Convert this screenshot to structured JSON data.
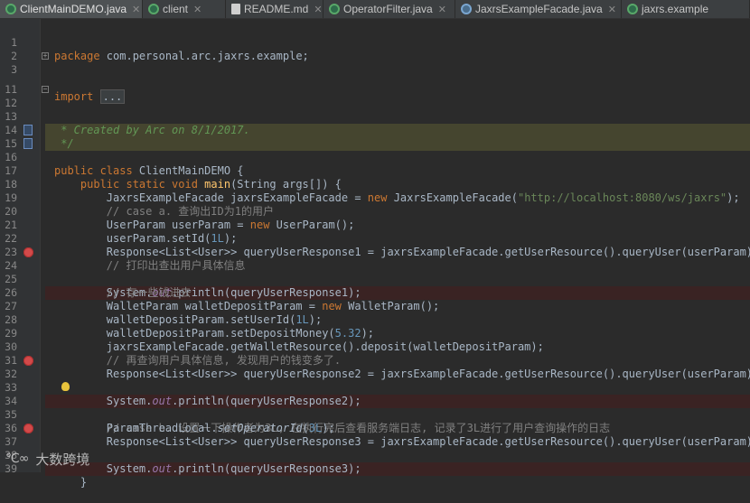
{
  "tabs": [
    {
      "label": "ClientMainDEMO.java",
      "icon": "java-class-icon",
      "active": true
    },
    {
      "label": "client",
      "icon": "java-class-icon",
      "active": false
    },
    {
      "label": "README.md",
      "icon": "document-icon",
      "active": false
    },
    {
      "label": "OperatorFilter.java",
      "icon": "java-class-icon",
      "active": false
    },
    {
      "label": "JaxrsExampleFacade.java",
      "icon": "interface-icon",
      "active": false
    },
    {
      "label": "jaxrs.example",
      "icon": "java-class-icon",
      "active": false
    }
  ],
  "code": {
    "l1": {
      "n": "1",
      "a": "package",
      "b": " com.personal.arc.jaxrs.example;"
    },
    "l2": {
      "n": "2"
    },
    "l3": {
      "n": "3",
      "a": "import",
      "b": "..."
    },
    "l11": {
      "n": "11"
    },
    "l12": {
      "n": "12",
      "a": "/**"
    },
    "l13": {
      "n": "13",
      "a": " * Created by Arc on 8/1/2017."
    },
    "l14": {
      "n": "14",
      "a": " */"
    },
    "l15": {
      "n": "15",
      "a": "public class",
      "b": " ClientMainDEMO {"
    },
    "l16": {
      "n": "16",
      "a": "    public static void",
      "b": " main",
      "c": "(String args[]) {"
    },
    "l17": {
      "n": "17"
    },
    "l18": {
      "n": "18",
      "a": "        JaxrsExampleFacade jaxrsExampleFacade = ",
      "b": "new",
      "c": " JaxrsExampleFacade(",
      "d": "\"http://localhost:8080/ws/jaxrs\"",
      "e": ");"
    },
    "l19": {
      "n": "19",
      "a": "        // case a. 查询出ID为1的用户"
    },
    "l20": {
      "n": "20",
      "a": "        UserParam userParam = ",
      "b": "new",
      "c": " UserParam();"
    },
    "l21": {
      "n": "21",
      "a": "        userParam.setId(",
      "b": "1L",
      "c": ");"
    },
    "l22": {
      "n": "22",
      "a": "        Response<List<User>> queryUserResponse1 = jaxrsExampleFacade.getUserResource().queryUser(userParam);"
    },
    "l23": {
      "n": "23",
      "a": "        // 打印出查出用户具体信息"
    },
    "l24": {
      "n": "24",
      "a": "        System.",
      "b": "out",
      "c": ".println(queryUserResponse1);"
    },
    "l25": {
      "n": "25",
      "a": "        // 存一些钱进去"
    },
    "l26": {
      "n": "26",
      "a": "        WalletParam walletDepositParam = ",
      "b": "new",
      "c": " WalletParam();"
    },
    "l27": {
      "n": "27",
      "a": "        walletDepositParam.setUserId(",
      "b": "1L",
      "c": ");"
    },
    "l28": {
      "n": "28",
      "a": "        walletDepositParam.setDepositMoney(",
      "b": "5.32",
      "c": ");"
    },
    "l29": {
      "n": "29",
      "a": "        jaxrsExampleFacade.getWalletResource().deposit(walletDepositParam);"
    },
    "l30": {
      "n": "30",
      "a": "        // 再查询用户具体信息, 发现用户的钱变多了."
    },
    "l31": {
      "n": "31",
      "a": "        Response<List<User>> queryUserResponse2 = jaxrsExampleFacade.getUserResource().queryUser(userParam);"
    },
    "l32": {
      "n": "32",
      "a": "        System.",
      "b": "out",
      "c": ".println(queryUserResponse2);"
    },
    "l33": {
      "n": "33"
    },
    "l34": {
      "n": "34",
      "a": "        // case b. 设置一下操作者为3L, 在执行完后查看服务端日志, 记录了3L进行了用户查询操作的日志"
    },
    "l35": {
      "n": "35",
      "a": "        ParamThreadLocal.",
      "b": "setOperatorId",
      "c": "(",
      "d": "3L",
      "e": ");"
    },
    "l36": {
      "n": "36",
      "a": "        Response<List<User>> queryUserResponse3 = jaxrsExampleFacade.getUserResource().queryUser(userParam);"
    },
    "l37": {
      "n": "37",
      "a": "        System.",
      "b": "out",
      "c": ".println(queryUserResponse3);"
    },
    "l38": {
      "n": "38"
    },
    "l39": {
      "n": "39",
      "a": "    }"
    }
  },
  "watermark": {
    "text": "大数跨境"
  },
  "colors": {
    "keyword": "#cc7832",
    "string": "#6a8759",
    "number": "#6897bb",
    "comment": "#808080",
    "doc": "#629755",
    "breakpoint": "#d24a4a"
  }
}
